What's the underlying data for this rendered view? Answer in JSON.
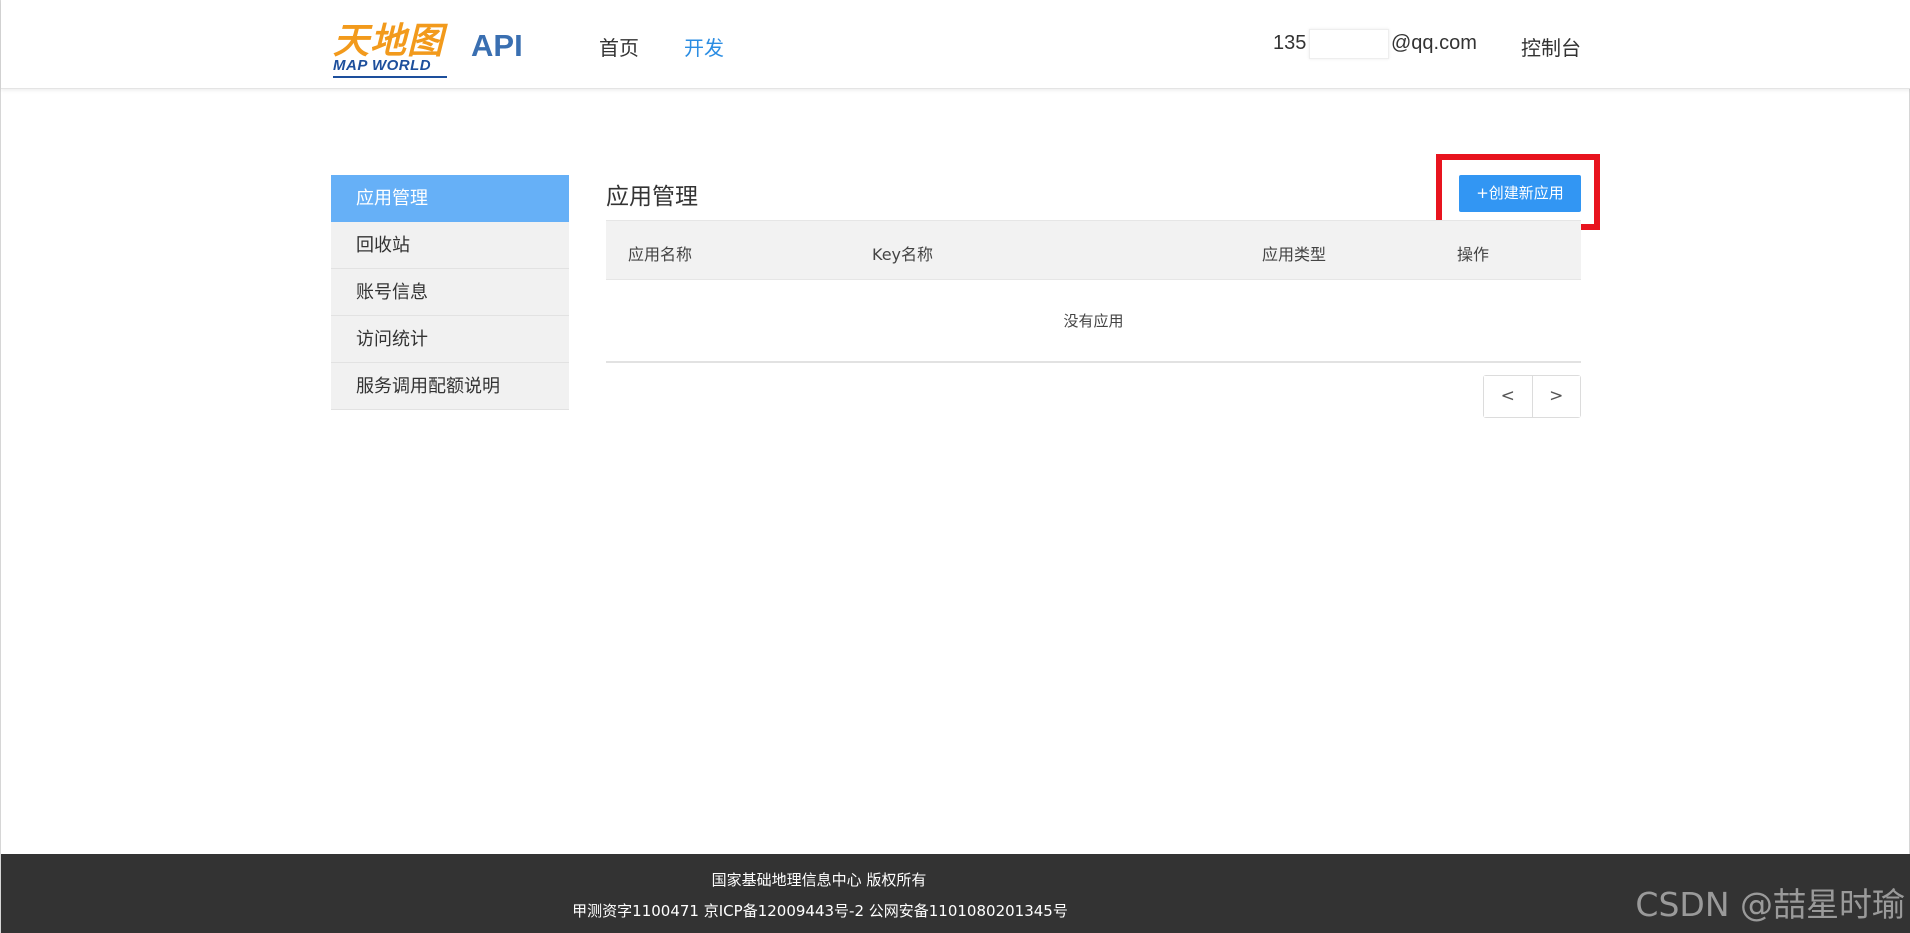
{
  "header": {
    "logo_cn": "天地图",
    "logo_en": "MAP WORLD",
    "api_title": "API",
    "nav": {
      "home": "首页",
      "dev": "开发"
    },
    "user": {
      "prefix": "135",
      "suffix": "@qq.com"
    },
    "console": "控制台"
  },
  "sidebar": {
    "items": [
      {
        "label": "应用管理",
        "active": true
      },
      {
        "label": "回收站"
      },
      {
        "label": "账号信息"
      },
      {
        "label": "访问统计"
      },
      {
        "label": "服务调用配额说明"
      }
    ]
  },
  "main": {
    "title": "应用管理",
    "create_button": "+创建新应用",
    "table": {
      "headers": [
        "应用名称",
        "Key名称",
        "应用类型",
        "操作"
      ],
      "empty_text": "没有应用"
    },
    "pager": {
      "prev": "<",
      "next": ">"
    }
  },
  "footer": {
    "line1": "国家基础地理信息中心  版权所有",
    "line2": "甲测资字1100471  京ICP备12009443号-2  公网安备1101080201345号",
    "watermark": "CSDN @喆星时瑜"
  },
  "colors": {
    "accent": "#2b8de3",
    "sidebar_active": "#66b0f7",
    "button": "#3296f3",
    "highlight": "#e8141e",
    "footer_bg": "#333333"
  }
}
